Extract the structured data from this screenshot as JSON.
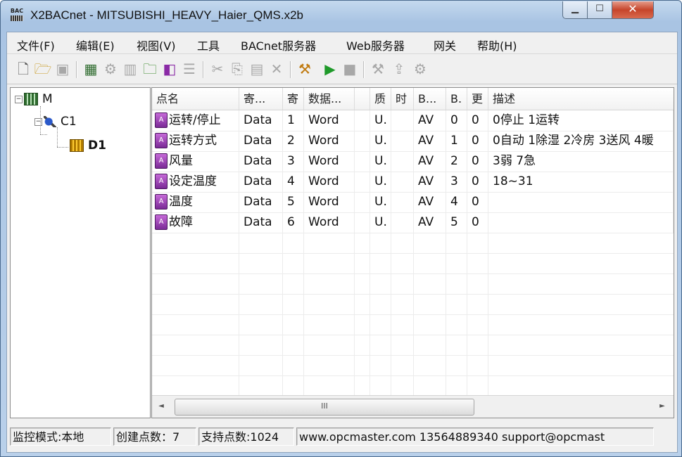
{
  "window": {
    "title": "X2BACnet - MITSUBISHI_HEAVY_Haier_QMS.x2b",
    "app_icon_text": "BAC",
    "controls": [
      "minimize",
      "maximize",
      "close"
    ]
  },
  "menu": [
    {
      "label": "文件(F)"
    },
    {
      "label": "编辑(E)"
    },
    {
      "label": "视图(V)"
    },
    {
      "label": "工具"
    },
    {
      "label": "BACnet服务器"
    },
    {
      "label": "Web服务器"
    },
    {
      "label": "网关"
    },
    {
      "label": "帮助(H)"
    }
  ],
  "toolbar": {
    "icons": [
      "new-file-icon",
      "open-folder-icon",
      "save-icon",
      "module-icon",
      "channel-icon",
      "device-icon",
      "add-folder-icon",
      "data-point-icon",
      "properties-icon",
      "cut-icon",
      "copy-icon",
      "paste-icon",
      "delete-icon",
      "config-icon",
      "run-icon",
      "stop-icon",
      "tools-icon",
      "load-icon",
      "settings-icon"
    ]
  },
  "tree": {
    "root": {
      "label": "M",
      "expander": "−"
    },
    "channel": {
      "label": "C1",
      "expander": "−"
    },
    "device": {
      "label": "D1"
    }
  },
  "table": {
    "columns": [
      "点名",
      "寄...",
      "寄",
      "数据...",
      "",
      "质",
      "时",
      "B...",
      "B.",
      "更",
      "描述"
    ],
    "rows": [
      {
        "name": "运转/停止",
        "reg_type": "Data",
        "reg": "1",
        "data_type": "Word",
        "blank": "",
        "quality": "U.",
        "time": "",
        "bacnet_type": "AV",
        "bacnet_id": "0",
        "update": "0",
        "desc": "0停止 1运转"
      },
      {
        "name": "运转方式",
        "reg_type": "Data",
        "reg": "2",
        "data_type": "Word",
        "blank": "",
        "quality": "U.",
        "time": "",
        "bacnet_type": "AV",
        "bacnet_id": "1",
        "update": "0",
        "desc": "0自动 1除湿 2冷房 3送风 4暖"
      },
      {
        "name": "风量",
        "reg_type": "Data",
        "reg": "3",
        "data_type": "Word",
        "blank": "",
        "quality": "U.",
        "time": "",
        "bacnet_type": "AV",
        "bacnet_id": "2",
        "update": "0",
        "desc": "3弱  7急"
      },
      {
        "name": "设定温度",
        "reg_type": "Data",
        "reg": "4",
        "data_type": "Word",
        "blank": "",
        "quality": "U.",
        "time": "",
        "bacnet_type": "AV",
        "bacnet_id": "3",
        "update": "0",
        "desc": "18~31"
      },
      {
        "name": "温度",
        "reg_type": "Data",
        "reg": "5",
        "data_type": "Word",
        "blank": "",
        "quality": "U.",
        "time": "",
        "bacnet_type": "AV",
        "bacnet_id": "4",
        "update": "0",
        "desc": ""
      },
      {
        "name": "故障",
        "reg_type": "Data",
        "reg": "6",
        "data_type": "Word",
        "blank": "",
        "quality": "U.",
        "time": "",
        "bacnet_type": "AV",
        "bacnet_id": "5",
        "update": "0",
        "desc": ""
      }
    ],
    "empty_rows": 8,
    "row_icon_glyph": "A"
  },
  "scrollbar": {
    "thumb_label": "III",
    "left_arrow": "◄",
    "right_arrow": "►"
  },
  "status": {
    "mode": "监控模式:本地",
    "points_created": "创建点数：7",
    "points_supported": "支持点数:1024",
    "contact": "www.opcmaster.com 13564889340 support@opcmast"
  }
}
